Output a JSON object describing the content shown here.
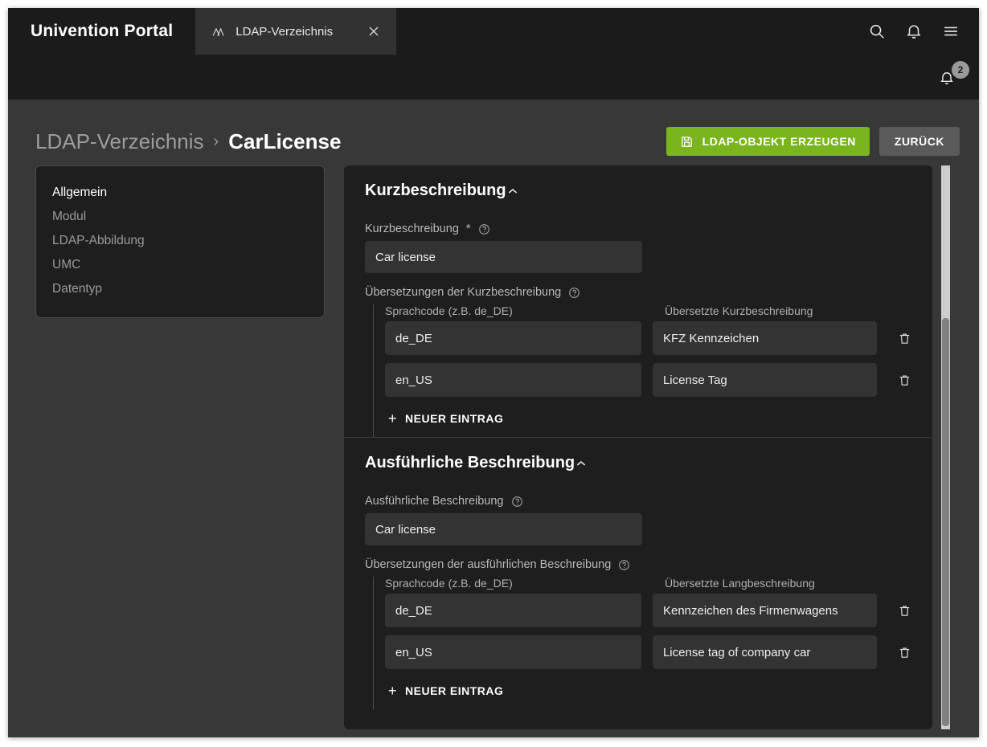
{
  "topbar": {
    "brand": "Univention Portal",
    "tab": {
      "label": "LDAP-Verzeichnis",
      "icon": "univention-logo-icon",
      "close_icon": "close-icon"
    },
    "actions": [
      {
        "name": "search-icon",
        "label": "Suche"
      },
      {
        "name": "notification-bell-icon",
        "label": "Benachrichtigungen"
      },
      {
        "name": "hamburger-menu-icon",
        "label": "Menü"
      }
    ]
  },
  "notification_bar": {
    "icon": "notification-bell-icon",
    "badge_count": "2"
  },
  "breadcrumb": {
    "parent": "LDAP-Verzeichnis",
    "separator": "›",
    "current": "CarLicense"
  },
  "actions": {
    "primary_label": "LDAP-OBJEKT ERZEUGEN",
    "primary_icon": "save-disk-icon",
    "secondary_label": "ZURÜCK",
    "primary_color": "#7ab51d",
    "secondary_color": "#5a5a5a"
  },
  "sidebar": {
    "items": [
      {
        "label": "Allgemein",
        "active": true
      },
      {
        "label": "Modul",
        "active": false
      },
      {
        "label": "LDAP-Abbildung",
        "active": false
      },
      {
        "label": "UMC",
        "active": false
      },
      {
        "label": "Datentyp",
        "active": false
      }
    ]
  },
  "cards": [
    {
      "title": "Kurzbeschreibung",
      "chevron": "chevron-up-icon",
      "field": {
        "label": "Kurzbeschreibung",
        "required_marker": "*",
        "help_icon": "help-circle-icon",
        "value": "Car license"
      },
      "group": {
        "label": "Übersetzungen der Kurzbeschreibung",
        "help_icon": "help-circle-icon",
        "col_a_header": "Sprachcode (z.B. de_DE)",
        "col_b_header": "Übersetzte Kurzbeschreibung",
        "rows": [
          {
            "code": "de_DE",
            "translation": "KFZ Kennzeichen",
            "delete_icon": "trash-icon"
          },
          {
            "code": "en_US",
            "translation": "License Tag",
            "delete_icon": "trash-icon"
          }
        ],
        "add_label": "NEUER EINTRAG",
        "add_icon": "plus-icon"
      }
    },
    {
      "title": "Ausführliche Beschreibung",
      "chevron": "chevron-up-icon",
      "field": {
        "label": "Ausführliche Beschreibung",
        "required_marker": "",
        "help_icon": "help-circle-icon",
        "value": "Car license"
      },
      "group": {
        "label": "Übersetzungen der ausführlichen Beschreibung",
        "help_icon": "help-circle-icon",
        "col_a_header": "Sprachcode (z.B. de_DE)",
        "col_b_header": "Übersetzte Langbeschreibung",
        "rows": [
          {
            "code": "de_DE",
            "translation": "Kennzeichen des Firmenwagens",
            "delete_icon": "trash-icon"
          },
          {
            "code": "en_US",
            "translation": "License tag of company car",
            "delete_icon": "trash-icon"
          }
        ],
        "add_label": "NEUER EINTRAG",
        "add_icon": "plus-icon"
      }
    }
  ]
}
